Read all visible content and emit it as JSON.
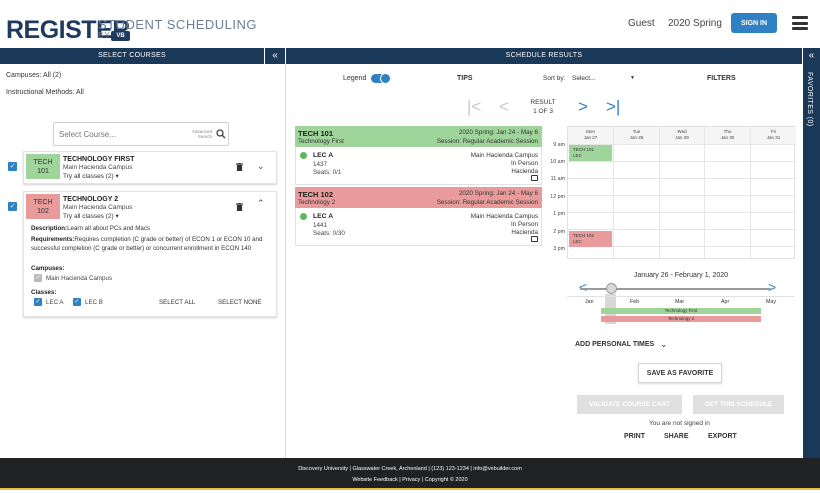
{
  "header": {
    "logo_main": "REGISTER",
    "logo_sub": "STUDENT SCHEDULING",
    "logo_by": "BY",
    "logo_badge": "VB",
    "user": "Guest",
    "term": "2020 Spring",
    "signin_label": "SIGN IN"
  },
  "bars": {
    "select_courses": "SELECT COURSES",
    "schedule_results": "SCHEDULE RESULTS",
    "favorites": "FAVORITES (0)"
  },
  "filters_left": {
    "campuses_label": "Campuses:",
    "campuses_value": "All (2)",
    "methods_label": "Instructional Methods:",
    "methods_value": "All"
  },
  "course_search": {
    "placeholder": "Select Course...",
    "advanced_line1": "Advanced",
    "advanced_line2": "Search"
  },
  "courses": [
    {
      "code_line1": "TECH",
      "code_line2": "101",
      "title": "TECHNOLOGY FIRST",
      "campus": "Main Hacienda Campus",
      "try_all": "Try all classes (2)"
    },
    {
      "code_line1": "TECH",
      "code_line2": "102",
      "title": "TECHNOLOGY 2",
      "campus": "Main Hacienda Campus",
      "try_all": "Try all classes (2)",
      "desc_label": "Description:",
      "desc_text": "Learn all about PCs and Macs",
      "req_label": "Requirements:",
      "req_text": "Requires completion (C grade or better) of ECON 1 or ECON 10 and successful completion (C grade or better) or concurrent enrollment in ECON 140",
      "campuses_label": "Campuses:",
      "campus_option": "Main Hacienda Campus",
      "classes_label": "Classes:",
      "class_a": "LEC A",
      "class_b": "LEC B",
      "select_all": "SELECT ALL",
      "select_none": "SELECT NONE"
    }
  ],
  "toolbar": {
    "legend": "Legend",
    "tips": "TIPS",
    "sort_by": "Sort by:",
    "sort_value": "Select...",
    "filters": "FILTERS",
    "result_line1": "RESULT",
    "result_line2": "1 OF 3"
  },
  "schedule": [
    {
      "code": "TECH 101",
      "name": "Technology First",
      "term": "2020 Spring: Jan 24 - May 6",
      "session": "Session: Regular Academic Session",
      "section": "LEC A",
      "crn": "1437",
      "seats": "Seats: 0/1",
      "campus": "Main Hacienda Campus",
      "mode": "In Person",
      "room": "Hacienda"
    },
    {
      "code": "TECH 102",
      "name": "Technology 2",
      "term": "2020 Spring: Jan 24 - May 6",
      "session": "Session: Regular Academic Session",
      "section": "LEC A",
      "crn": "1441",
      "seats": "Seats: 0/30",
      "campus": "Main Hacienda Campus",
      "mode": "In Person",
      "room": "Hacienda"
    }
  ],
  "week": {
    "days": [
      {
        "name": "Mon",
        "date": "Jan 27"
      },
      {
        "name": "Tue",
        "date": "Jan 28"
      },
      {
        "name": "Wed",
        "date": "Jan 29"
      },
      {
        "name": "Thu",
        "date": "Jan 30"
      },
      {
        "name": "Fri",
        "date": "Jan 31"
      }
    ],
    "hours": [
      "9 am",
      "10 am",
      "11 am",
      "12 pm",
      "1 pm",
      "2 pm",
      "3 pm"
    ],
    "events": [
      {
        "line1": "TECH 101",
        "line2": "LEC",
        "color": "#9fd49a"
      },
      {
        "line1": "TECH 102",
        "line2": "LEC",
        "color": "#e99b9b"
      }
    ]
  },
  "timeline": {
    "range": "January 26 - February 1, 2020",
    "months": [
      "Jan",
      "Feb",
      "Mar",
      "Apr",
      "May"
    ],
    "bar1": "Technology First",
    "bar2": "Technology 2"
  },
  "actions": {
    "add_personal": "ADD PERSONAL TIMES",
    "save_favorite": "SAVE AS FAVORITE",
    "validate": "VALIDATE COURSE CART",
    "get_schedule": "GET THIS SCHEDULE",
    "not_signed": "You are not signed in",
    "print": "PRINT",
    "share": "SHARE",
    "export": "EXPORT"
  },
  "footer": {
    "line1": "Discovery University | Glasswater Creek, Archenland | (123) 123-1234 | info@vebuilder.com",
    "line2": "Website Feedback | Privacy | Copyright © 2020"
  },
  "colors": {
    "navy": "#1a3857",
    "accent": "#2f81c4",
    "green": "#9fd49a",
    "red": "#e99b9b"
  }
}
